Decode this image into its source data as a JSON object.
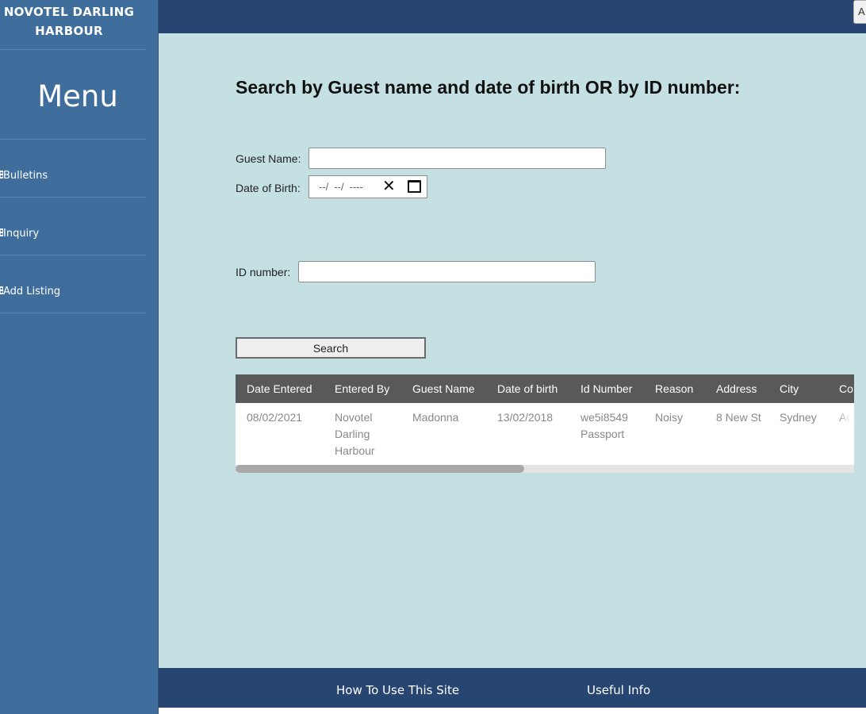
{
  "sidebar": {
    "brand_line1": "NOVOTEL DARLING",
    "brand_line2": "HARBOUR",
    "menu_title": "Menu",
    "items": [
      {
        "icon": "B",
        "label": "Bulletins"
      },
      {
        "icon": "B",
        "label": "Inquiry"
      },
      {
        "icon": "B",
        "label": "Add Listing"
      }
    ]
  },
  "header": {
    "corner_button": "A"
  },
  "main": {
    "title": "Search by Guest name and date of birth OR by ID number:",
    "guest_name_label": "Guest Name:",
    "guest_name_value": "",
    "dob_label": "Date of Birth:",
    "dob_day": "--/",
    "dob_month": "--/",
    "dob_year": "----",
    "id_label": "ID number:",
    "id_value": "",
    "search_button": "Search"
  },
  "table": {
    "columns": [
      "Date Entered",
      "Entered By",
      "Guest Name",
      "Date of birth",
      "Id Number",
      "Reason",
      "Address",
      "City",
      "Co"
    ],
    "rows": [
      {
        "date_entered": "08/02/2021",
        "entered_by": "Novotel Darling Harbour",
        "guest_name": "Madonna",
        "date_of_birth": "13/02/2018",
        "id_number": "we5i8549 Passport",
        "reason": "Noisy",
        "address": "8 New St",
        "city": "Sydney",
        "country": "Aus"
      }
    ]
  },
  "footer": {
    "how_to": "How To Use This Site",
    "useful_info": "Useful Info"
  },
  "colors": {
    "sidebar": "#3f6d9c",
    "header": "#274571",
    "main_bg": "#c4e0e3",
    "table_header": "#595959"
  }
}
